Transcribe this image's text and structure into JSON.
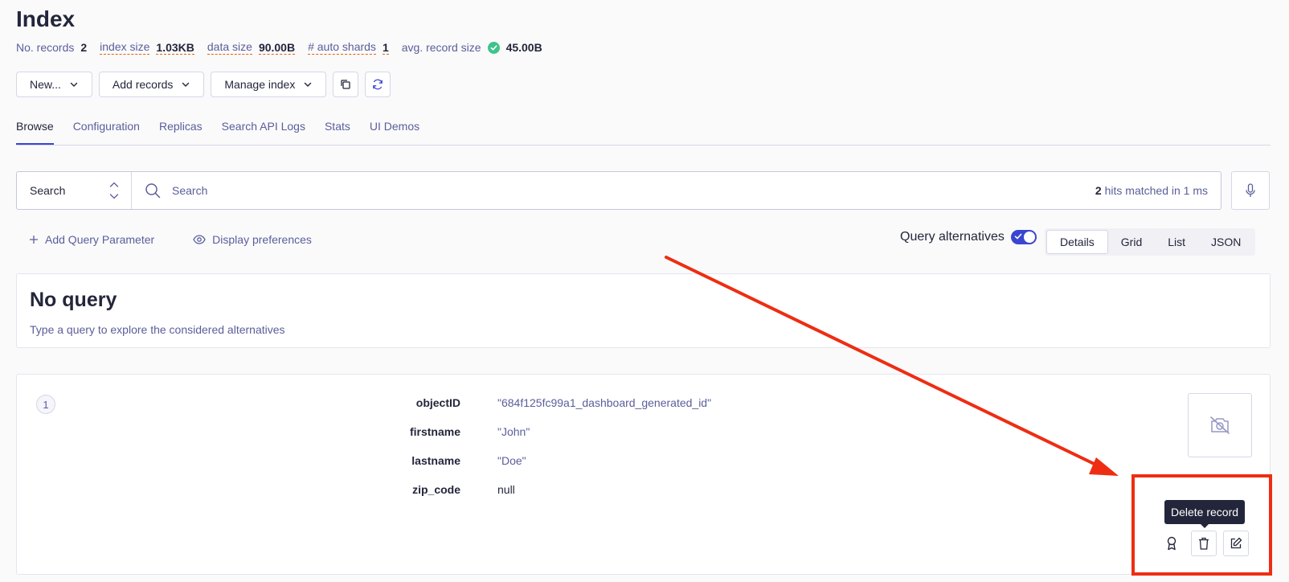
{
  "page": {
    "title": "Index"
  },
  "stats": {
    "records_label": "No. records",
    "records_value": "2",
    "index_size_label": "index size",
    "index_size_value": "1.03KB",
    "data_size_label": "data size",
    "data_size_value": "90.00B",
    "auto_shards_label": "# auto shards",
    "auto_shards_value": "1",
    "avg_record_label": "avg. record size",
    "avg_record_value": "45.00B"
  },
  "toolbar": {
    "new_label": "New...",
    "add_records_label": "Add records",
    "manage_index_label": "Manage index",
    "copy_icon": "copy-icon",
    "refresh_icon": "refresh-icon"
  },
  "tabs": [
    {
      "label": "Browse"
    },
    {
      "label": "Configuration"
    },
    {
      "label": "Replicas"
    },
    {
      "label": "Search API Logs"
    },
    {
      "label": "Stats"
    },
    {
      "label": "UI Demos"
    }
  ],
  "search": {
    "mode": "Search",
    "placeholder": "Search",
    "hits_count": "2",
    "hits_text": " hits matched in 1 ms"
  },
  "actions": {
    "add_query_param": "Add Query Parameter",
    "display_prefs": "Display preferences",
    "query_alternatives": "Query alternatives"
  },
  "views": [
    {
      "label": "Details"
    },
    {
      "label": "Grid"
    },
    {
      "label": "List"
    },
    {
      "label": "JSON"
    }
  ],
  "noquery": {
    "title": "No query",
    "subtitle": "Type a query to explore the considered alternatives"
  },
  "record": {
    "rank": "1",
    "attributes": [
      {
        "key": "objectID",
        "value": "\"684f125fc99a1_dashboard_generated_id\""
      },
      {
        "key": "firstname",
        "value": "\"John\""
      },
      {
        "key": "lastname",
        "value": "\"Doe\""
      },
      {
        "key": "zip_code",
        "value": "null"
      }
    ],
    "tooltip": "Delete record"
  },
  "colors": {
    "accent": "#3a46d0",
    "annotation": "#ee2d12",
    "success": "#3ec48b"
  }
}
